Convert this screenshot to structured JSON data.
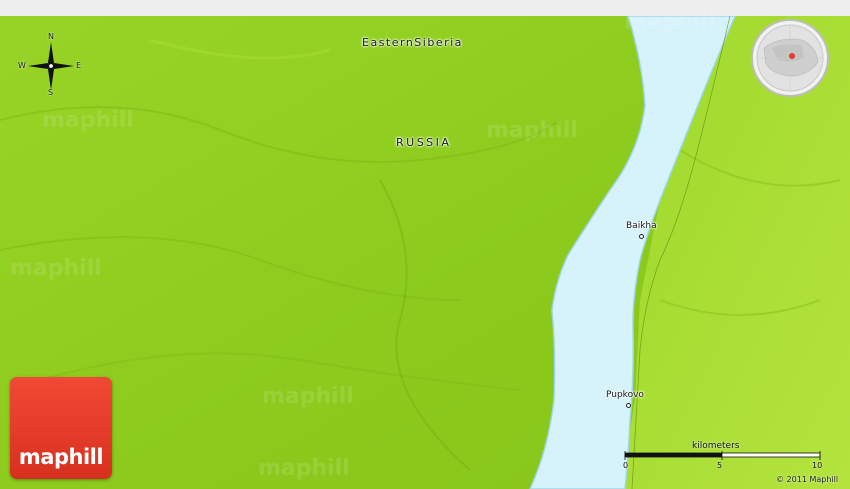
{
  "map": {
    "region_label": "EasternSiberia",
    "country_label": "RUSSIA",
    "towns": [
      {
        "name": "Baikha"
      },
      {
        "name": "Pupkovo"
      }
    ],
    "watermark_text": "maphill",
    "colors": {
      "land": "#8ccc1c",
      "land_light": "#a6dd32",
      "water": "#d6f3fb",
      "water_edge": "#9fd7ea",
      "logo_red": "#e8392a"
    }
  },
  "compass": {
    "north": "N",
    "south": "S",
    "east": "E",
    "west": "W"
  },
  "logo": {
    "text": "maphill"
  },
  "scale": {
    "title": "kilometers",
    "ticks": [
      "0",
      "5",
      "10"
    ]
  },
  "copyright": "© 2011 Maphill"
}
